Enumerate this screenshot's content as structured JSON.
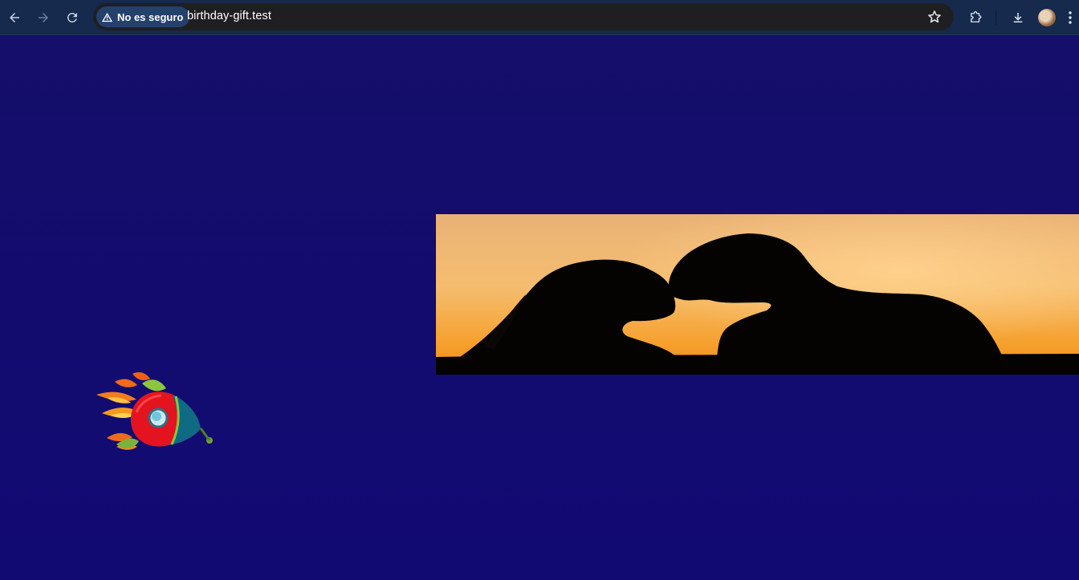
{
  "browser": {
    "security_label": "No es seguro",
    "url": "birthday-gift.test",
    "colors": {
      "toolbar": "#152a4d",
      "omnibox": "#1f1f22",
      "chip": "#24416c"
    }
  },
  "page": {
    "background_color": "#120b6f",
    "images": [
      "couple-silhouette-sunset",
      "cartoon-rocket"
    ]
  },
  "icons": [
    "back-arrow-icon",
    "forward-arrow-icon",
    "reload-icon",
    "warning-icon",
    "star-icon",
    "extensions-icon",
    "download-icon",
    "profile-avatar",
    "menu-icon"
  ]
}
